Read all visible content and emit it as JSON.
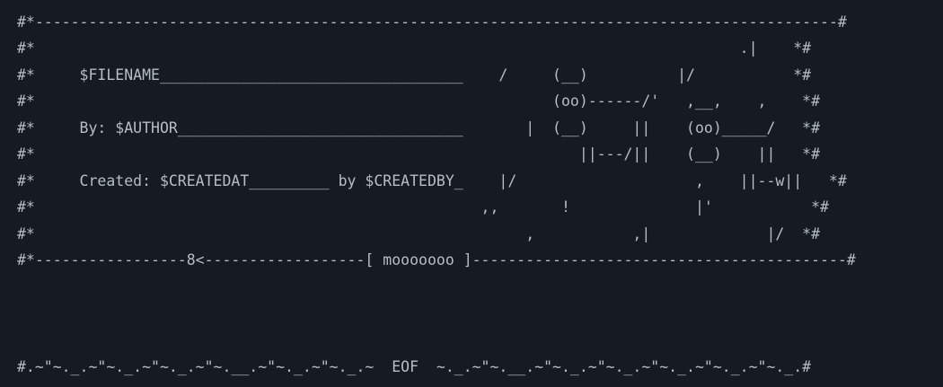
{
  "terminal": {
    "lines": [
      "#*------------------------------------------------------------------------------------------#",
      "#*                                                                               .|    *#",
      "#*     $FILENAME__________________________________    /     (__)          |/           *#",
      "#*                                                          (oo)------/'   ,__,    ,    *#",
      "#*     By: $AUTHOR________________________________       |  (__)     ||    (oo)_____/   *#",
      "#*                                                             ||---/||    (__)    ||   *#",
      "#*     Created: $CREATEDAT_________ by $CREATEDBY_    |/                    ,    ||--w||   *#",
      "#*                                                  ,,       !              |'           *#",
      "#*                                                       ,           ,|             |/  *#",
      "#*-----------------8<------------------[ mooooooo ]------------------------------------------#",
      "#.~\"~._.~\"~._.~\"~._.~\"~.__.~\"~._.~\"~._.~  EOF  ~._.~\"~.__.~\"~._.~\"~._.~\"~._.~\"~._.~\"~._.#"
    ]
  }
}
